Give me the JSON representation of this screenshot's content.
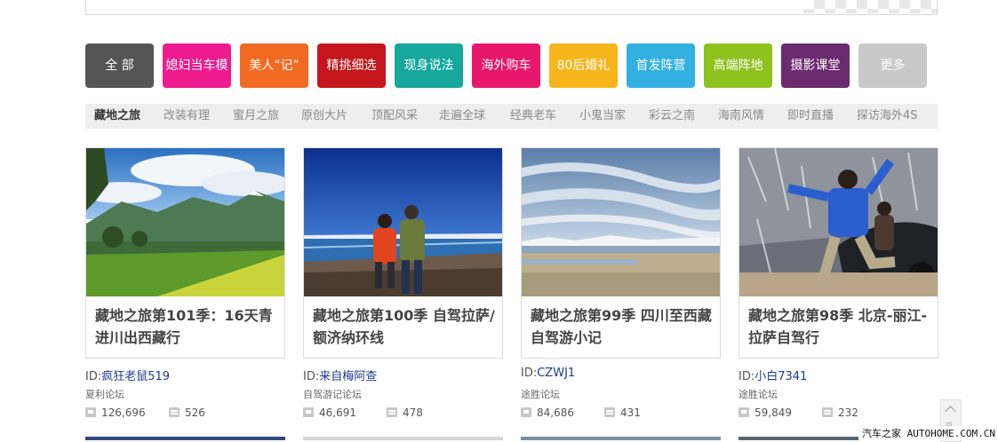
{
  "categories": [
    {
      "label": "全 部",
      "color": "#555555"
    },
    {
      "label": "媳妇当车模",
      "color": "#ee1b8e"
    },
    {
      "label": "美人“记”",
      "color": "#f26a21"
    },
    {
      "label": "精挑细选",
      "color": "#c4161c"
    },
    {
      "label": "现身说法",
      "color": "#16a79d"
    },
    {
      "label": "海外购车",
      "color": "#e8176b"
    },
    {
      "label": "80后婚礼",
      "color": "#f7b51c"
    },
    {
      "label": "首发阵营",
      "color": "#31b0e1"
    },
    {
      "label": "高端阵地",
      "color": "#8dc21f"
    },
    {
      "label": "摄影课堂",
      "color": "#6a2c6e"
    },
    {
      "label": "更多",
      "color": "#c8c8c8"
    }
  ],
  "subnav": [
    "藏地之旅",
    "改装有理",
    "蜜月之旅",
    "原创大片",
    "顶配风采",
    "走遍全球",
    "经典老车",
    "小鬼当家",
    "彩云之南",
    "海南风情",
    "即时直播",
    "探访海外4S"
  ],
  "cards": [
    {
      "title": "藏地之旅第101季：16天青进川出西藏行",
      "id_prefix": "ID:",
      "author": "疯狂老鼠519",
      "forum": "夏利论坛",
      "views": "126,696",
      "replies": "526"
    },
    {
      "title": "藏地之旅第100季 自驾拉萨/额济纳环线",
      "id_prefix": "ID:",
      "author": "来自梅阿查",
      "forum": "自驾游记论坛",
      "views": "46,691",
      "replies": "478"
    },
    {
      "title": "藏地之旅第99季 四川至西藏自驾游小记",
      "id_prefix": "ID:",
      "author": "CZWJ1",
      "forum": "途胜论坛",
      "views": "84,686",
      "replies": "431"
    },
    {
      "title": "藏地之旅第98季 北京-丽江-拉萨自驾行",
      "id_prefix": "ID:",
      "author": "小白7341",
      "forum": "途胜论坛",
      "views": "59,849",
      "replies": "232"
    }
  ],
  "back_to_top": "返",
  "watermark": "汽车之家 AUTOHOME.COM.CN"
}
